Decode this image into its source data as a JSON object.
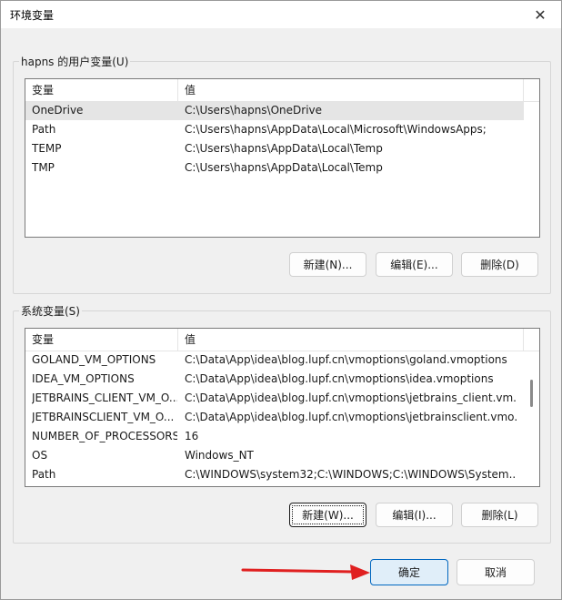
{
  "window": {
    "title": "环境变量",
    "close_symbol": "✕"
  },
  "user_vars": {
    "group_label": "hapns 的用户变量(U)",
    "columns": [
      "变量",
      "值"
    ],
    "rows": [
      {
        "name": "OneDrive",
        "value": "C:\\Users\\hapns\\OneDrive",
        "selected": true
      },
      {
        "name": "Path",
        "value": "C:\\Users\\hapns\\AppData\\Local\\Microsoft\\WindowsApps;",
        "selected": false
      },
      {
        "name": "TEMP",
        "value": "C:\\Users\\hapns\\AppData\\Local\\Temp",
        "selected": false
      },
      {
        "name": "TMP",
        "value": "C:\\Users\\hapns\\AppData\\Local\\Temp",
        "selected": false
      }
    ],
    "buttons": {
      "new": "新建(N)...",
      "edit": "编辑(E)...",
      "delete": "删除(D)"
    }
  },
  "system_vars": {
    "group_label": "系统变量(S)",
    "columns": [
      "变量",
      "值"
    ],
    "rows": [
      {
        "name": "GOLAND_VM_OPTIONS",
        "value": "C:\\Data\\App\\idea\\blog.lupf.cn\\vmoptions\\goland.vmoptions"
      },
      {
        "name": "IDEA_VM_OPTIONS",
        "value": "C:\\Data\\App\\idea\\blog.lupf.cn\\vmoptions\\idea.vmoptions"
      },
      {
        "name": "JETBRAINS_CLIENT_VM_O...",
        "value": "C:\\Data\\App\\idea\\blog.lupf.cn\\vmoptions\\jetbrains_client.vm..."
      },
      {
        "name": "JETBRAINSCLIENT_VM_O...",
        "value": "C:\\Data\\App\\idea\\blog.lupf.cn\\vmoptions\\jetbrainsclient.vmo..."
      },
      {
        "name": "NUMBER_OF_PROCESSORS",
        "value": "16"
      },
      {
        "name": "OS",
        "value": "Windows_NT"
      },
      {
        "name": "Path",
        "value": "C:\\WINDOWS\\system32;C:\\WINDOWS;C:\\WINDOWS\\System..."
      }
    ],
    "buttons": {
      "new": "新建(W)...",
      "edit": "编辑(I)...",
      "delete": "删除(L)"
    }
  },
  "footer": {
    "ok": "确定",
    "cancel": "取消"
  },
  "colors": {
    "annotation_arrow": "#e02020",
    "primary_border": "#0067c0"
  }
}
